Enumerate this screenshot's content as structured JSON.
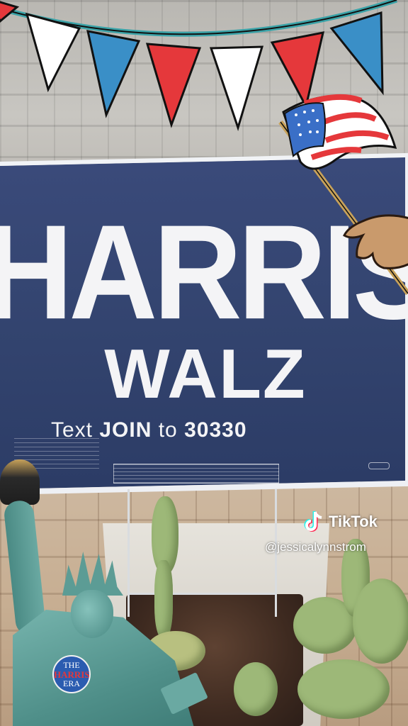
{
  "sign": {
    "line1": "HARRIS",
    "line2": "WALZ",
    "cta_prefix": "Text ",
    "cta_keyword": "JOIN",
    "cta_middle": " to ",
    "cta_number": "30330"
  },
  "statue_badge": {
    "top": "THE",
    "middle": "HARRIS",
    "bottom": "ERA"
  },
  "watermark": {
    "brand": "TikTok",
    "username": "@jessicalynnstrom"
  },
  "colors": {
    "sign_blue": "#33446f",
    "banner_red": "#e5383b",
    "banner_blue": "#3a8fc7",
    "banner_white": "#ffffff"
  },
  "icons": [
    "tiktok-logo-icon",
    "american-flag-icon",
    "bunting-banner-icon"
  ]
}
